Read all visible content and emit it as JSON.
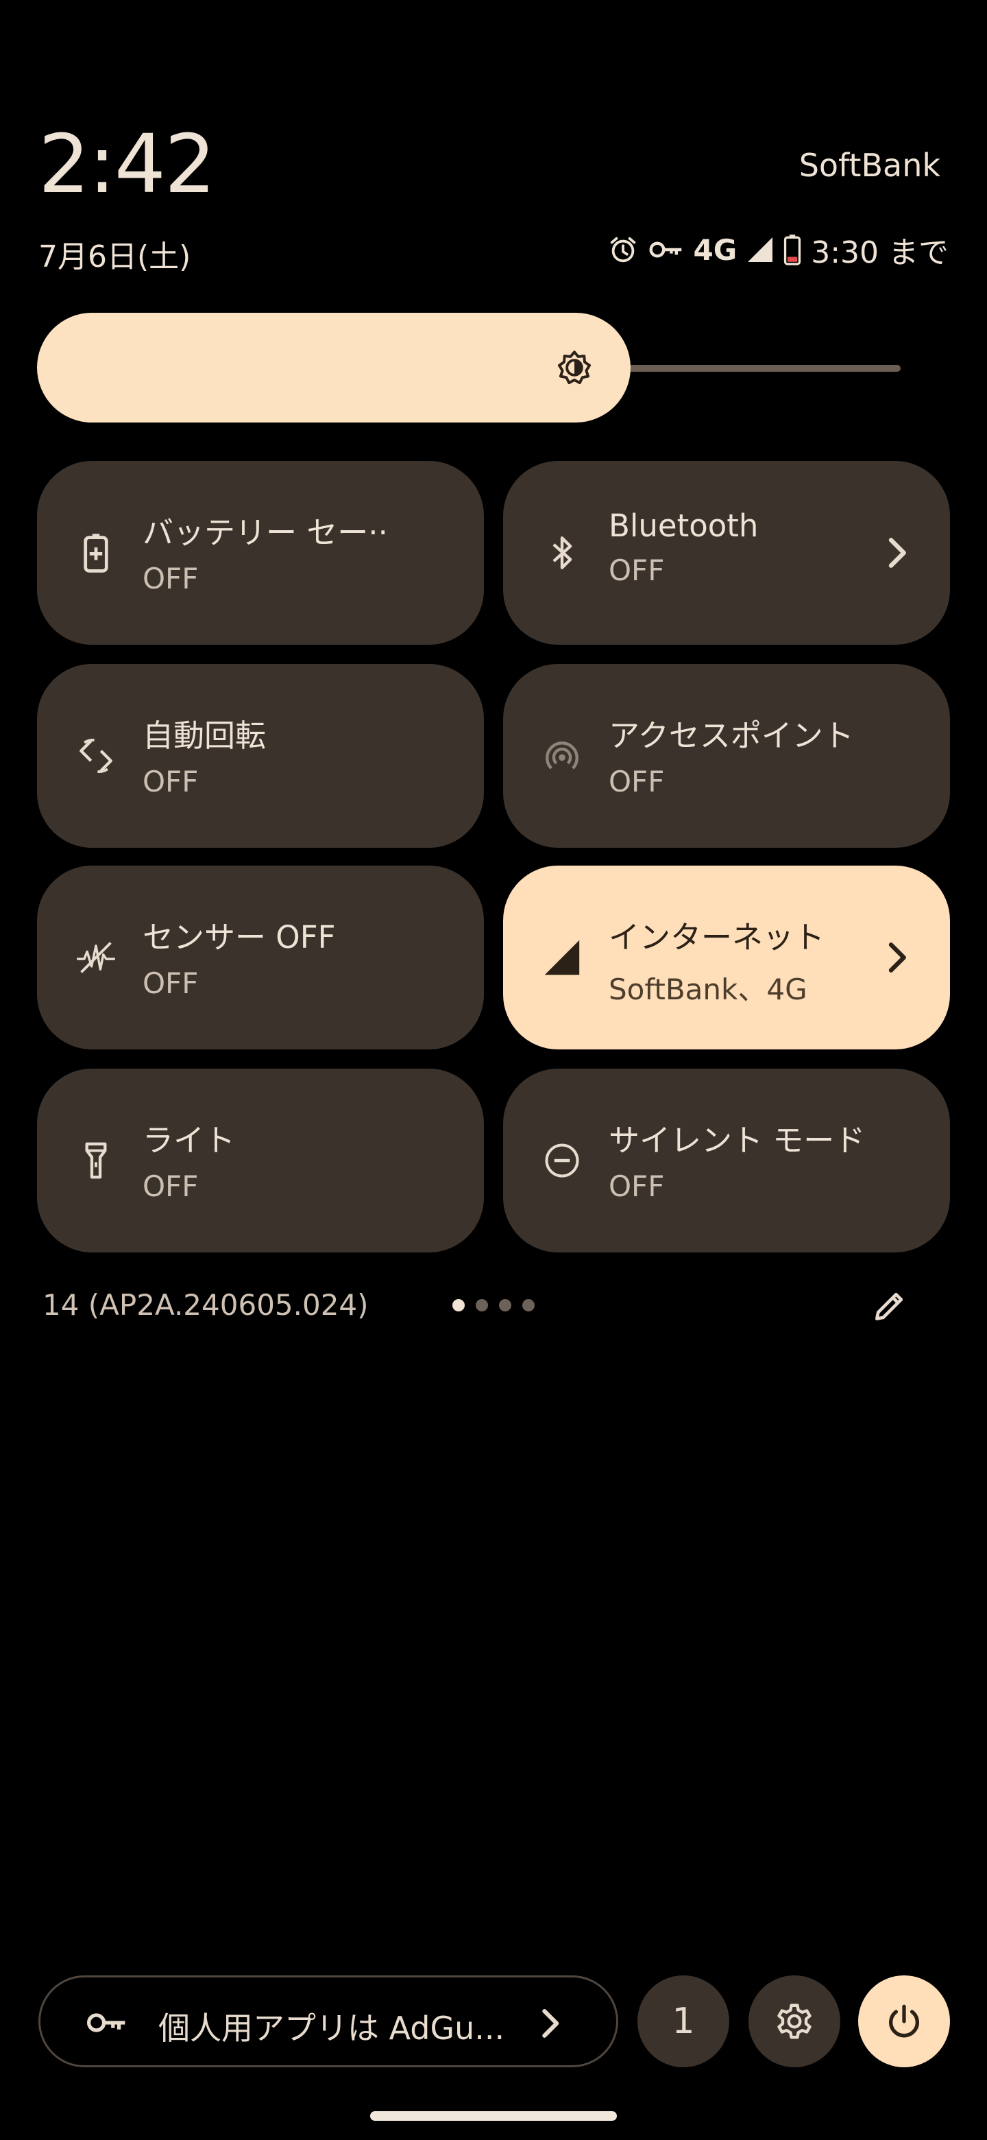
{
  "header": {
    "time": "2:42",
    "carrier": "SoftBank",
    "date": "7月6日(土)",
    "network": "4G",
    "battery_until": "3:30 まで"
  },
  "brightness": {
    "level": 0.68
  },
  "tiles": [
    {
      "title": "バッテリー セー··",
      "subtitle": "OFF",
      "icon": "battery-saver-icon",
      "active": false
    },
    {
      "title": "Bluetooth",
      "subtitle": "OFF",
      "icon": "bluetooth-icon",
      "active": false,
      "chevron": true
    },
    {
      "title": "自動回転",
      "subtitle": "OFF",
      "icon": "auto-rotate-icon",
      "active": false
    },
    {
      "title": "アクセスポイント",
      "subtitle": "OFF",
      "icon": "hotspot-icon",
      "active": false
    },
    {
      "title": "センサー OFF",
      "subtitle": "OFF",
      "icon": "sensors-off-icon",
      "active": false
    },
    {
      "title": "インターネット",
      "subtitle": "SoftBank、4G",
      "icon": "cell-signal-icon",
      "active": true,
      "chevron": true
    },
    {
      "title": "ライト",
      "subtitle": "OFF",
      "icon": "flashlight-icon",
      "active": false
    },
    {
      "title": "サイレント モード",
      "subtitle": "OFF",
      "icon": "do-not-disturb-icon",
      "active": false
    }
  ],
  "footer": {
    "build": "14 (AP2A.240605.024)",
    "page_count": 4,
    "current_page": 1
  },
  "bottom": {
    "vpn_label": "個人用アプリは AdGu...",
    "users_count": "1"
  },
  "colors": {
    "accent": "#ffdfba",
    "tile_bg": "#3b322c",
    "background": "#000000"
  }
}
